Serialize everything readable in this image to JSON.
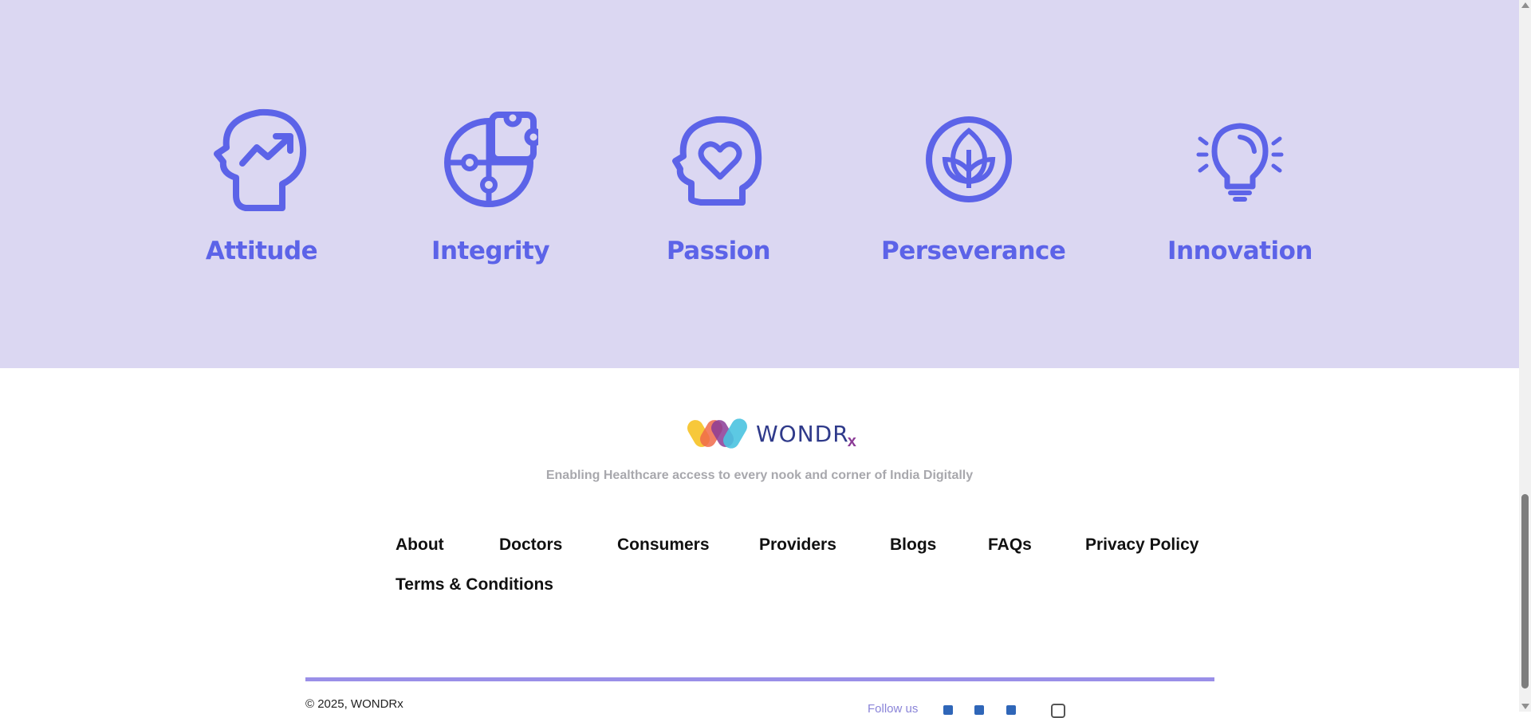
{
  "values": [
    {
      "label": "Attitude",
      "icon": "head-growth-icon"
    },
    {
      "label": "Integrity",
      "icon": "puzzle-icon"
    },
    {
      "label": "Passion",
      "icon": "head-heart-icon"
    },
    {
      "label": "Perseverance",
      "icon": "leaf-circle-icon"
    },
    {
      "label": "Innovation",
      "icon": "lightbulb-icon"
    }
  ],
  "footer": {
    "brand": "WONDR",
    "brand_sub": "x",
    "tagline": "Enabling Healthcare access to every nook and corner of India Digitally",
    "nav": [
      "About",
      "Doctors",
      "Consumers",
      "Providers",
      "Blogs",
      "FAQs",
      "Privacy Policy",
      "Terms & Conditions"
    ],
    "copyright": "© 2025, WONDRx",
    "follow_label": "Follow us"
  },
  "colors": {
    "band_bg": "#dbd7f2",
    "accent": "#5c63e8",
    "rule": "#9a8fe8"
  }
}
